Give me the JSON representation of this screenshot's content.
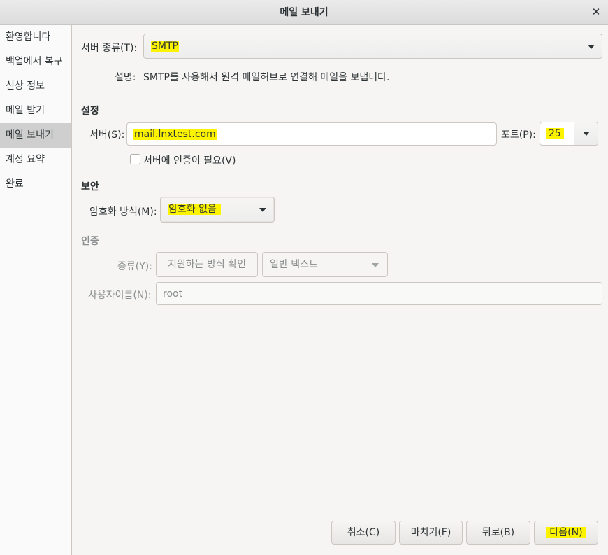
{
  "window": {
    "title": "메일 보내기",
    "close_glyph": "✕"
  },
  "sidebar": {
    "items": [
      {
        "label": "환영합니다",
        "active": false
      },
      {
        "label": "백업에서 복구",
        "active": false
      },
      {
        "label": "신상 정보",
        "active": false
      },
      {
        "label": "메일 받기",
        "active": false
      },
      {
        "label": "메일 보내기",
        "active": true
      },
      {
        "label": "계정 요약",
        "active": false
      },
      {
        "label": "완료",
        "active": false
      }
    ]
  },
  "server_type": {
    "label": "서버 종류(T):",
    "value": "SMTP",
    "description_label": "설명:",
    "description": "SMTP를 사용해서 원격 메일허브로 연결해 메일을 보냅니다."
  },
  "settings": {
    "heading": "설정",
    "server_label": "서버(S):",
    "server_value": "mail.lnxtest.com",
    "port_label": "포트(P):",
    "port_value": "25",
    "auth_required_label": "서버에 인증이 필요(V)",
    "auth_required_checked": false
  },
  "security": {
    "heading": "보안",
    "encryption_label": "암호화 방식(M):",
    "encryption_value": "암호화 없음"
  },
  "authentication": {
    "heading": "인증",
    "type_label": "종류(Y):",
    "check_button": "지원하는 방식 확인",
    "type_value": "일반 텍스트",
    "username_label": "사용자이름(N):",
    "username_value": "root"
  },
  "buttons": {
    "cancel": "취소(C)",
    "finish": "마치기(F)",
    "back": "뒤로(B)",
    "next": "다음(N)"
  },
  "colors": {
    "highlight": "#fbf300",
    "sidebar_active": "#cfcfcf",
    "background": "#f6f5f4"
  },
  "icons": {
    "close": "close-icon",
    "dropdown": "chevron-down-icon"
  }
}
